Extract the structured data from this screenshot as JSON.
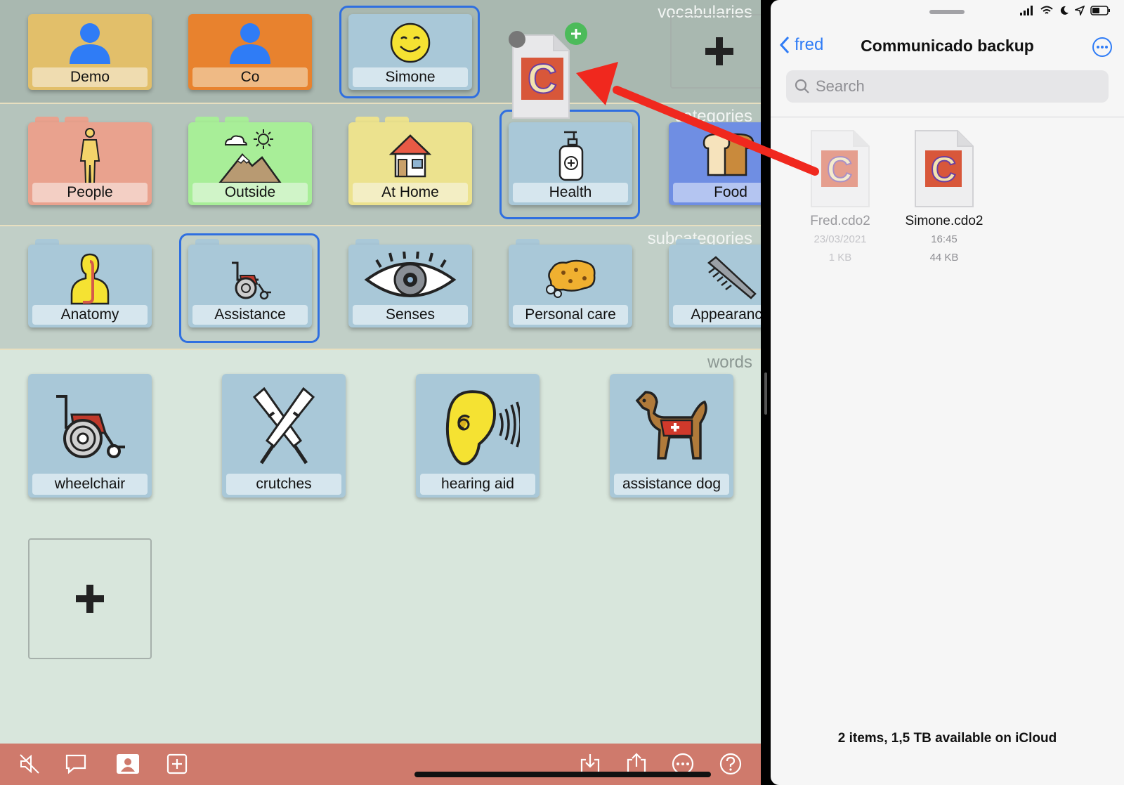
{
  "sections": {
    "vocabularies": "vocabularies",
    "categories": "categories",
    "subcategories": "subcategories",
    "words": "words"
  },
  "vocabularies": [
    {
      "label": "Demo",
      "icon": "person-icon",
      "color": "#e2bf6a",
      "label_bg": "#efdcb0"
    },
    {
      "label": "Co",
      "icon": "person-icon",
      "color": "#e8822e",
      "label_bg": "#efba85"
    },
    {
      "label": "Simone",
      "icon": "smiley-icon",
      "color": "#a9c8d8",
      "label_bg": "#d6e6ee",
      "selected": true
    }
  ],
  "categories": [
    {
      "label": "People",
      "icon": "human-figure-icon",
      "color": "#e9a28e",
      "label_bg": "#f3cfc4"
    },
    {
      "label": "Outside",
      "icon": "mountains-icon",
      "color": "#a8ee98",
      "label_bg": "#d0f4c8"
    },
    {
      "label": "At Home",
      "icon": "house-icon",
      "color": "#ece28e",
      "label_bg": "#f3eec4"
    },
    {
      "label": "Health",
      "icon": "sanitizer-icon",
      "color": "#a9c8d8",
      "label_bg": "#d6e6ee",
      "selected": true
    },
    {
      "label": "Food",
      "icon": "bread-icon",
      "color": "#6f8ee3",
      "label_bg": "#b4c5f1"
    }
  ],
  "subcategories": [
    {
      "label": "Anatomy",
      "icon": "anatomy-icon"
    },
    {
      "label": "Assistance",
      "icon": "wheelchair-icon",
      "selected": true
    },
    {
      "label": "Senses",
      "icon": "eye-icon"
    },
    {
      "label": "Personal care",
      "icon": "sponge-icon"
    },
    {
      "label": "Appearance",
      "icon": "comb-icon"
    }
  ],
  "words": [
    {
      "label": "wheelchair",
      "icon": "wheelchair-icon"
    },
    {
      "label": "crutches",
      "icon": "crutches-icon"
    },
    {
      "label": "hearing aid",
      "icon": "ear-icon"
    },
    {
      "label": "assistance dog",
      "icon": "dog-icon"
    }
  ],
  "toolbar": [
    "mute-icon",
    "speech-bubble-icon",
    "contact-card-icon",
    "add-square-icon",
    "import-icon",
    "share-icon",
    "more-icon",
    "help-icon"
  ],
  "files_panel": {
    "back_label": "fred",
    "title": "Communicado backup",
    "search_placeholder": "Search",
    "files": [
      {
        "name": "Fred.cdo2",
        "date": "23/03/2021",
        "size": "1 KB",
        "dimmed": true
      },
      {
        "name": "Simone.cdo2",
        "date": "16:45",
        "size": "44 KB",
        "dimmed": false
      }
    ],
    "footer": "2 items, 1,5 TB available on iCloud"
  },
  "colors": {
    "accent": "#2f6fe0",
    "ios_blue": "#2f7cf6",
    "toolbar": "#cf7a6c",
    "arrow": "#f0281e",
    "tile_blue": "#a9c8d8"
  }
}
